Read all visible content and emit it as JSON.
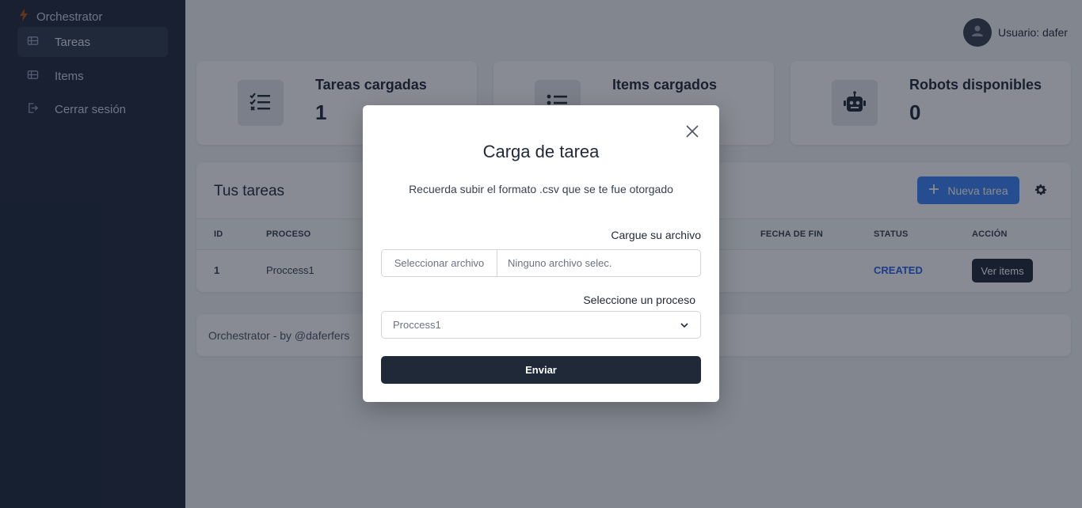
{
  "sidebar": {
    "brand": "Orchestrator",
    "items": [
      {
        "label": "Tareas",
        "icon": "table-icon",
        "active": true
      },
      {
        "label": "Items",
        "icon": "table-icon",
        "active": false
      },
      {
        "label": "Cerrar sesión",
        "icon": "logout-icon",
        "active": false
      }
    ]
  },
  "header": {
    "user_label": "Usuario: dafer"
  },
  "stats": [
    {
      "title": "Tareas cargadas",
      "value": "1",
      "icon": "checklist-icon"
    },
    {
      "title": "Items cargados",
      "value": "",
      "icon": "list-icon"
    },
    {
      "title": "Robots disponibles",
      "value": "0",
      "icon": "robot-icon"
    }
  ],
  "tasks": {
    "title": "Tus tareas",
    "new_task_label": "Nueva tarea",
    "columns": [
      "ID",
      "PROCESO",
      "FECHA DE FIN",
      "STATUS",
      "ACCIÓN"
    ],
    "rows": [
      {
        "id": "1",
        "proceso": "Proccess1",
        "fecha_fin": "",
        "status": "CREATED",
        "action": "Ver items"
      }
    ]
  },
  "footer": {
    "text": "Orchestrator - by @daferfers"
  },
  "modal": {
    "title": "Carga de tarea",
    "subtitle": "Recuerda subir el formato .csv que se te fue otorgado",
    "file_label": "Cargue su archivo",
    "file_button": "Seleccionar archivo",
    "file_value": "Ninguno archivo selec.",
    "process_label": "Seleccione un proceso",
    "process_value": "Proccess1",
    "submit_label": "Enviar"
  },
  "colors": {
    "sidebar_bg": "#1e293b",
    "primary": "#3b82f6",
    "dark": "#1f2937",
    "status_created": "#2563eb"
  }
}
